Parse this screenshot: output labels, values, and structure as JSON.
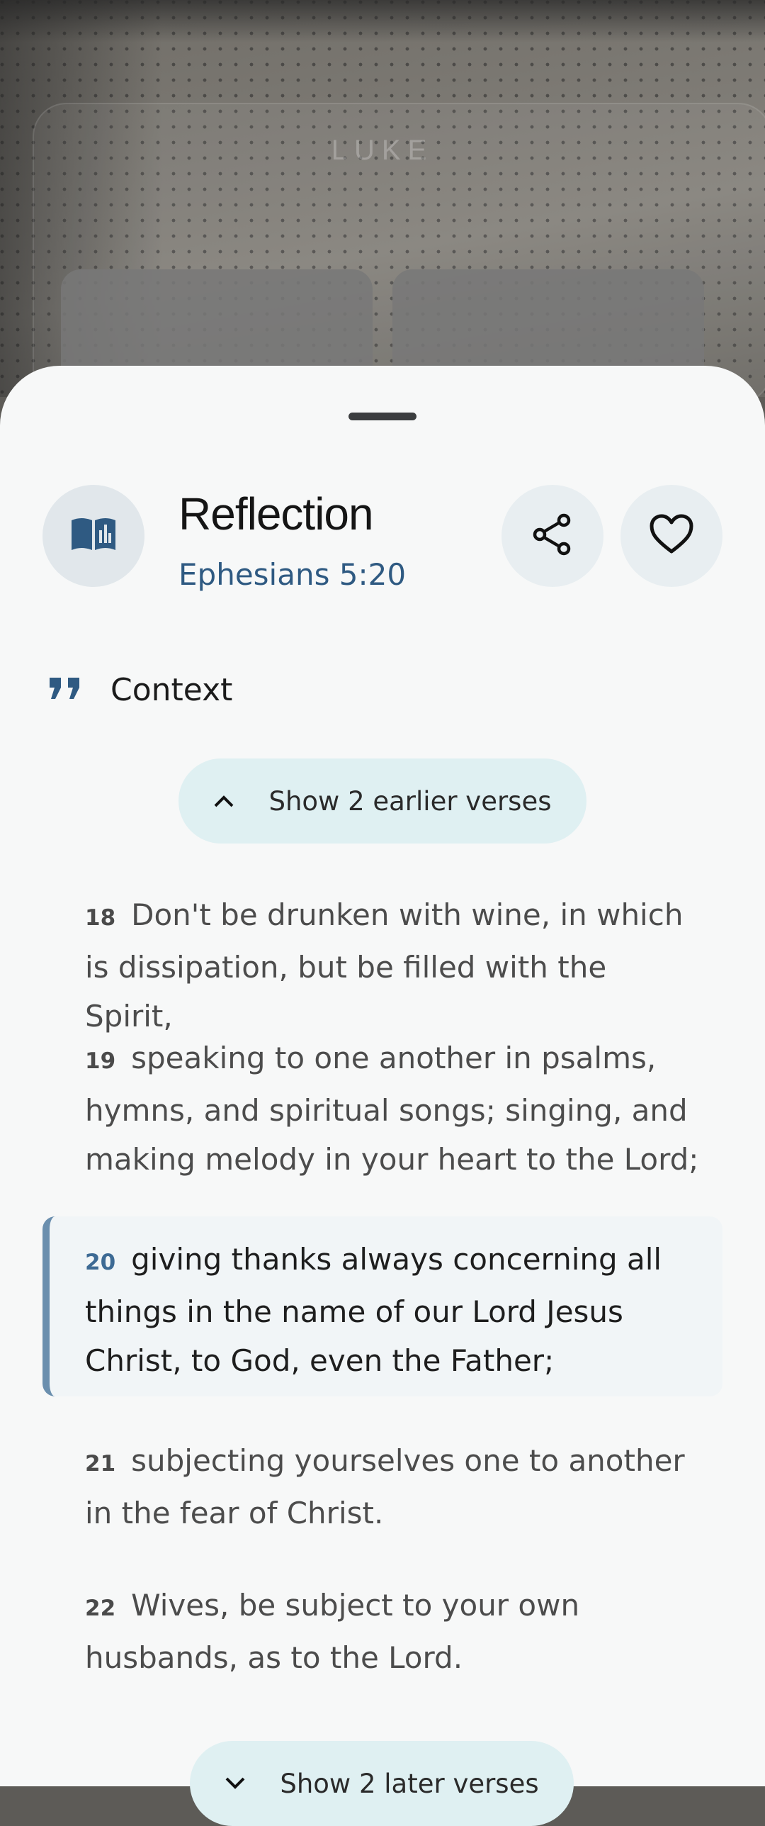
{
  "background": {
    "title": "LUKE"
  },
  "sheet": {
    "title": "Reflection",
    "reference": "Ephesians 5:20",
    "icons": {
      "book": "book-icon",
      "share": "share-icon",
      "favorite": "heart-icon",
      "quote": "quote-icon"
    },
    "context_label": "Context",
    "show_earlier": "Show 2 earlier verses",
    "show_later": "Show 2 later verses",
    "verses": [
      {
        "num": "18",
        "text": "Don't be drunken with wine, in which is dissipation, but be filled with the Spirit,"
      },
      {
        "num": "19",
        "text": "speaking to one another in psalms, hymns, and spiritual songs; singing, and making melody in your heart to the Lord;"
      },
      {
        "num": "20",
        "text": "giving thanks always concerning all things in the name of our Lord Jesus Christ, to God, even the Father;"
      },
      {
        "num": "21",
        "text": "subjecting yourselves one to another in the fear of Christ."
      },
      {
        "num": "22",
        "text": "Wives, be subject to your own husbands, as to the Lord."
      }
    ],
    "accent_color": "#2f5a82",
    "highlight_bar_color": "#6b8fae",
    "pill_color": "#dff0f2"
  }
}
